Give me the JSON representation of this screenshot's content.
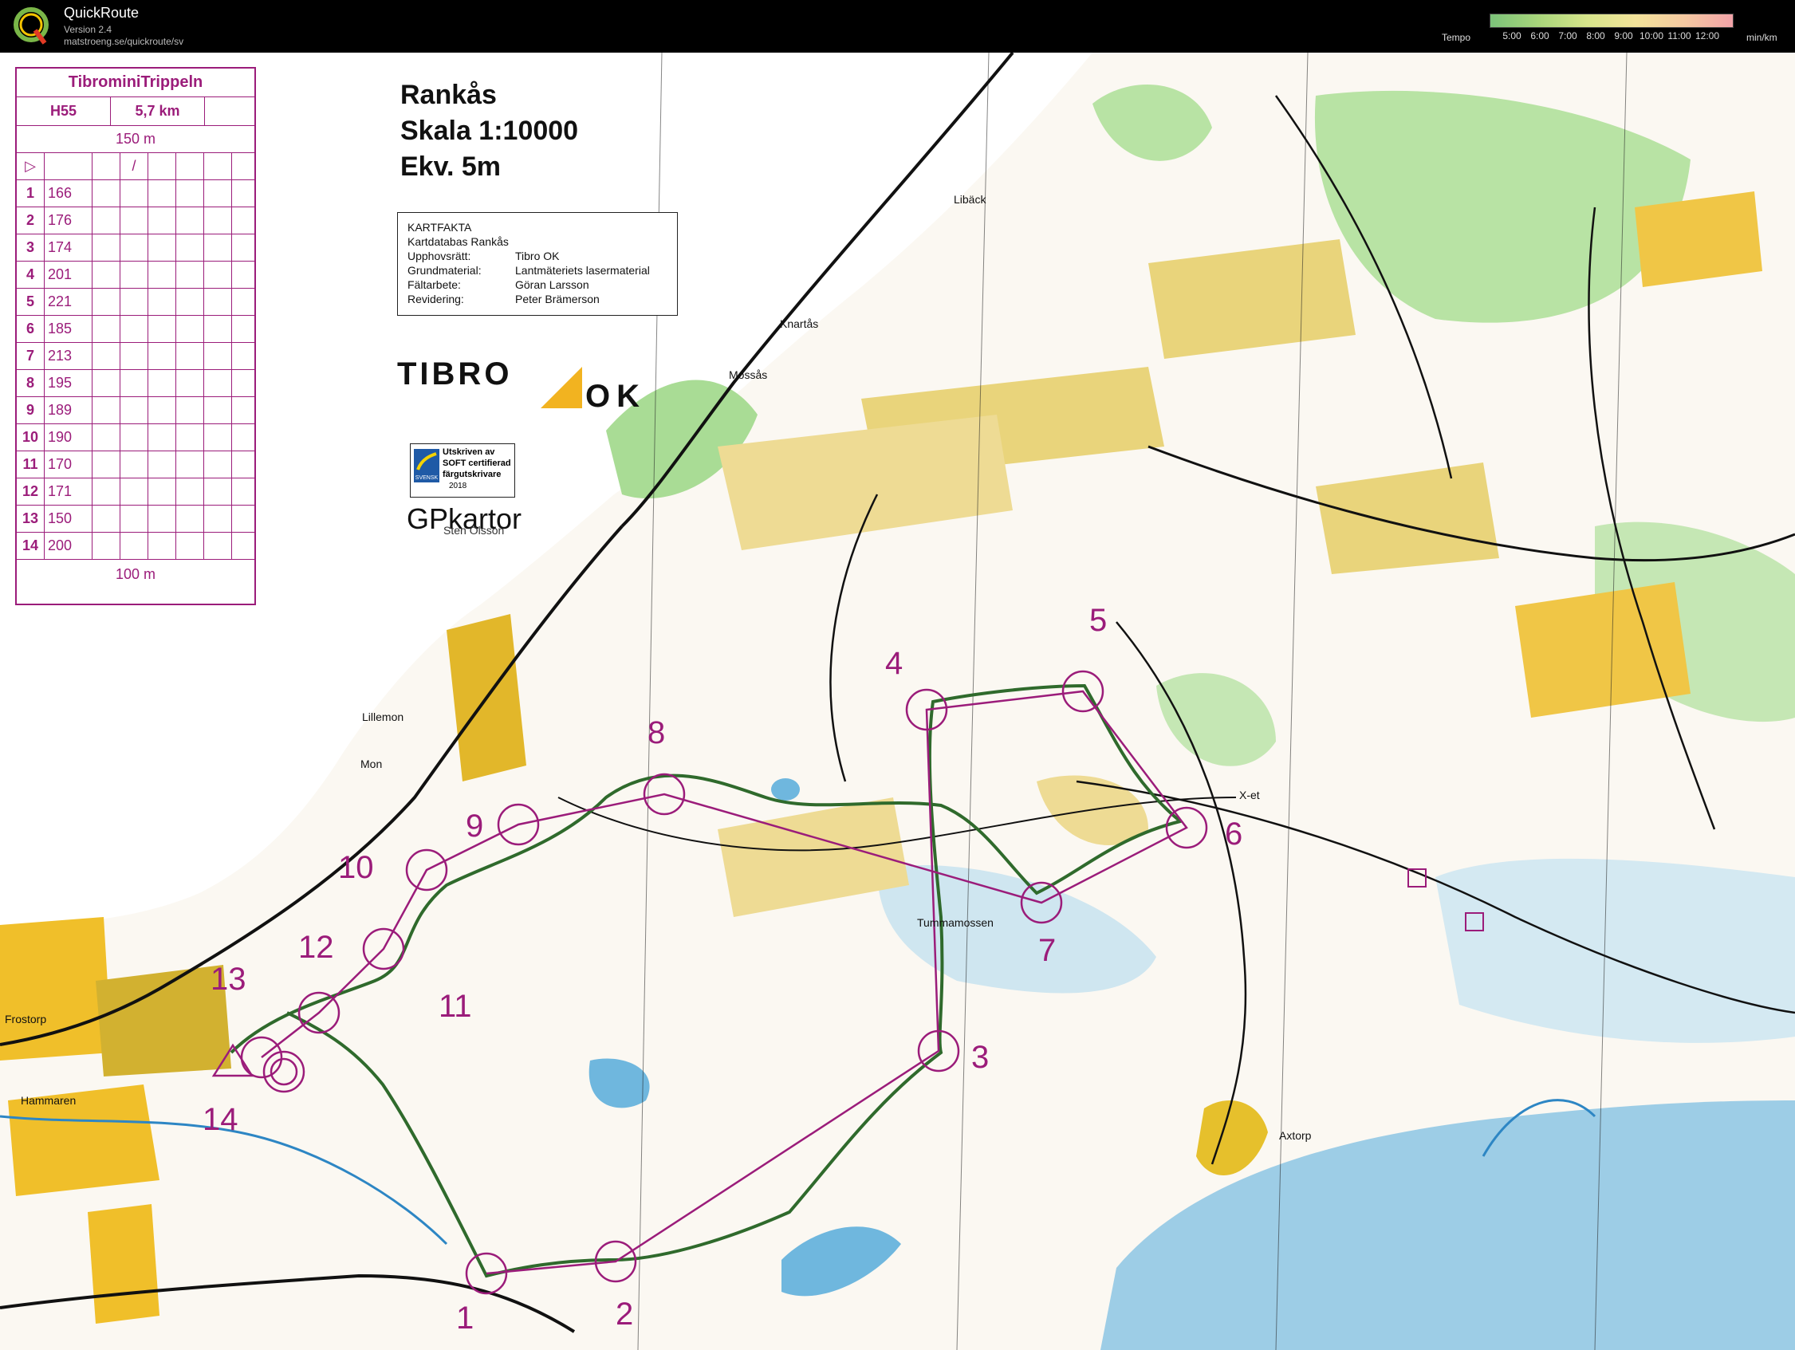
{
  "app": {
    "name": "QuickRoute",
    "version": "Version 2.4",
    "url": "matstroeng.se/quickroute/sv",
    "logo_letter": "Q"
  },
  "tempo": {
    "label": "Tempo",
    "unit": "min/km",
    "ticks": [
      "5:00",
      "6:00",
      "7:00",
      "8:00",
      "9:00",
      "10:00",
      "11:00",
      "12:00"
    ]
  },
  "map": {
    "title_lines": [
      "Rankås",
      "Skala 1:10000",
      "Ekv. 5m"
    ],
    "kartfakta": {
      "heading": "KARTFAKTA",
      "subheading": "Kartdatabas Rankås",
      "rows": [
        {
          "key": "Upphovsrätt:",
          "value": "Tibro OK"
        },
        {
          "key": "Grundmaterial:",
          "value": "Lantmäteriets lasermaterial"
        },
        {
          "key": "Fältarbete:",
          "value": "Göran Larsson"
        },
        {
          "key": "Revidering:",
          "value": "Peter Brämerson"
        }
      ]
    },
    "club_logo": {
      "part1": "TIBRO",
      "part2": "OK"
    },
    "certificate": {
      "line1": "Utskriven av",
      "line2": "SOFT certifierad",
      "line3": "färgutskrivare",
      "year": "2018",
      "badge": "SVENSK"
    },
    "gp_logo": {
      "main": "GPkartor",
      "sub": "Sten Olsson"
    },
    "places": [
      "Libäck",
      "Knartås",
      "Mossås",
      "Lillemon",
      "Mon",
      "Frostorp",
      "Hammaren",
      "Tummamossen",
      "X-et",
      "Axtorp"
    ],
    "control_numbers": [
      "1",
      "2",
      "3",
      "4",
      "5",
      "6",
      "7",
      "8",
      "9",
      "10",
      "11",
      "12",
      "13",
      "14"
    ]
  },
  "course": {
    "name": "TibrominiTrippeln",
    "class": "H55",
    "length": "5,7 km",
    "start_marking": "150 m",
    "finish_marking": "100 m",
    "controls": [
      {
        "n": "1",
        "code": "166"
      },
      {
        "n": "2",
        "code": "176"
      },
      {
        "n": "3",
        "code": "174"
      },
      {
        "n": "4",
        "code": "201"
      },
      {
        "n": "5",
        "code": "221"
      },
      {
        "n": "6",
        "code": "185"
      },
      {
        "n": "7",
        "code": "213"
      },
      {
        "n": "8",
        "code": "195"
      },
      {
        "n": "9",
        "code": "189"
      },
      {
        "n": "10",
        "code": "190"
      },
      {
        "n": "11",
        "code": "170"
      },
      {
        "n": "12",
        "code": "171"
      },
      {
        "n": "13",
        "code": "150"
      },
      {
        "n": "14",
        "code": "200"
      }
    ]
  },
  "colors": {
    "purple": "#9b1c7a",
    "route": "#2f6a2c",
    "water": "#8fc7e4",
    "yellow": "#f4c332",
    "green": "#9fd38a",
    "forest": "#fbf9f4",
    "brown": "#b5661f"
  }
}
